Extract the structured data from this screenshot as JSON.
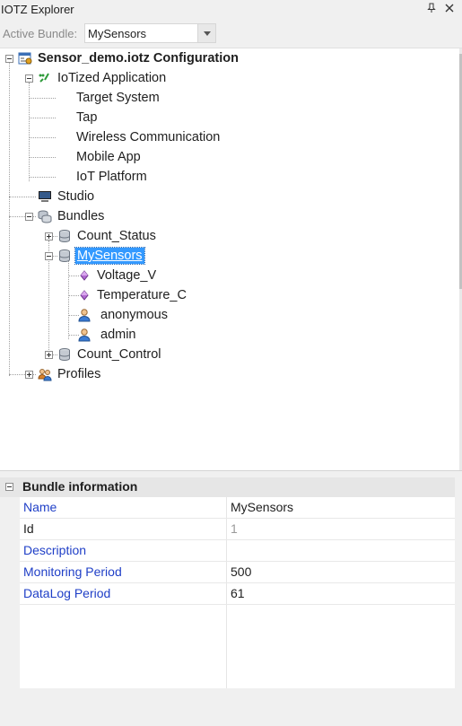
{
  "window": {
    "title": "IOTZ Explorer",
    "pin_icon": "pin-icon",
    "close_icon": "close-icon"
  },
  "toolbar": {
    "active_bundle_label": "Active Bundle:",
    "active_bundle_value": "MySensors"
  },
  "tree": {
    "root": {
      "label": "Sensor_demo.iotz Configuration",
      "icon": "config-icon"
    },
    "iotized_app": {
      "label": "IoTized Application",
      "icon": "iot-app-icon"
    },
    "target_system": {
      "label": "Target System"
    },
    "tap": {
      "label": "Tap"
    },
    "wireless": {
      "label": "Wireless Communication"
    },
    "mobile_app": {
      "label": "Mobile App"
    },
    "iot_platform": {
      "label": "IoT Platform"
    },
    "studio": {
      "label": "Studio",
      "icon": "monitor-icon"
    },
    "bundles": {
      "label": "Bundles",
      "icon": "bundles-icon"
    },
    "count_status": {
      "label": "Count_Status",
      "icon": "database-icon"
    },
    "mysensors": {
      "label": "MySensors",
      "icon": "database-icon",
      "selected": true
    },
    "voltage": {
      "label": "Voltage_V",
      "icon": "diamond-icon"
    },
    "temperature": {
      "label": "Temperature_C",
      "icon": "diamond-icon"
    },
    "anonymous": {
      "label": "anonymous",
      "icon": "user-icon"
    },
    "admin": {
      "label": "admin",
      "icon": "user-icon"
    },
    "count_control": {
      "label": "Count_Control",
      "icon": "database-icon"
    },
    "profiles": {
      "label": "Profiles",
      "icon": "profiles-icon"
    }
  },
  "properties": {
    "category": "Bundle information",
    "rows": [
      {
        "name": "Name",
        "value": "MySensors"
      },
      {
        "name": "Id",
        "value": "1"
      },
      {
        "name": "Description",
        "value": ""
      },
      {
        "name": "Monitoring Period",
        "value": "500"
      },
      {
        "name": "DataLog Period",
        "value": "61"
      }
    ]
  },
  "colors": {
    "selection": "#3399ff",
    "property_name": "#1f3fc7",
    "panel_bg": "#f0f0f0"
  }
}
